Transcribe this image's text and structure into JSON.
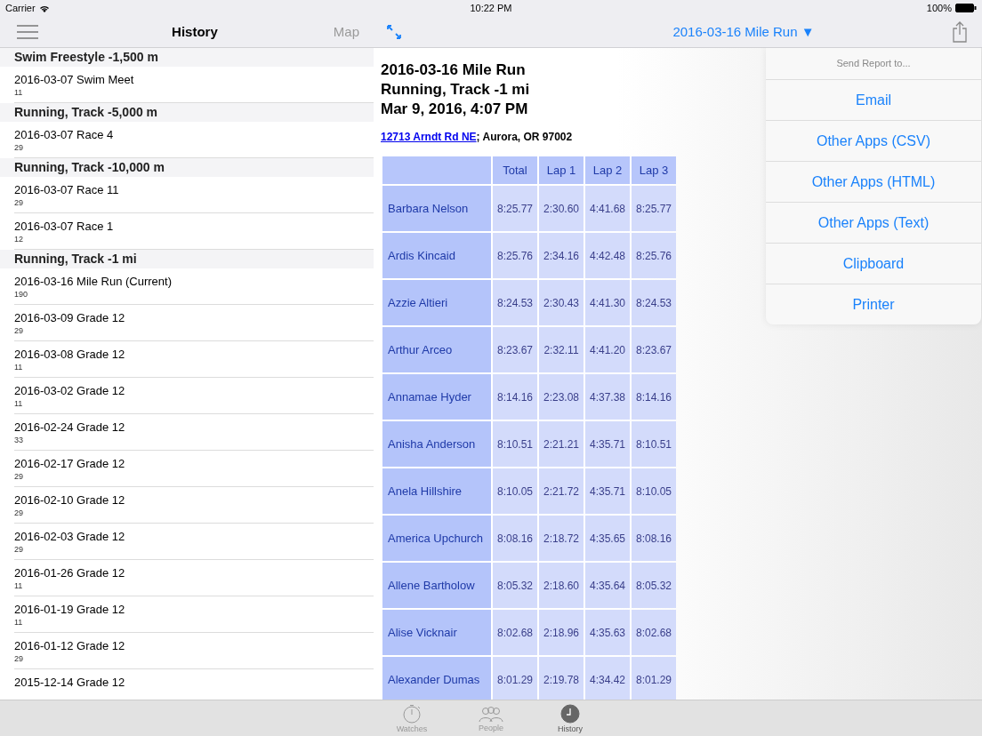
{
  "status_bar": {
    "carrier": "Carrier",
    "time": "10:22 PM",
    "battery": "100%"
  },
  "left_nav": {
    "title": "History",
    "action": "Map"
  },
  "history": [
    {
      "title": "Swim Freestyle -1,500 m",
      "items": [
        {
          "title": "2016-03-07 Swim Meet",
          "count": "11"
        }
      ]
    },
    {
      "title": "Running, Track -5,000 m",
      "items": [
        {
          "title": "2016-03-07 Race 4",
          "count": "29"
        }
      ]
    },
    {
      "title": "Running, Track -10,000 m",
      "items": [
        {
          "title": "2016-03-07 Race 11",
          "count": "29"
        },
        {
          "title": "2016-03-07 Race 1",
          "count": "12"
        }
      ]
    },
    {
      "title": "Running, Track -1 mi",
      "items": [
        {
          "title": "2016-03-16 Mile Run (Current)",
          "count": "190"
        },
        {
          "title": "2016-03-09 Grade 12",
          "count": "29"
        },
        {
          "title": "2016-03-08 Grade 12",
          "count": "11"
        },
        {
          "title": "2016-03-02 Grade 12",
          "count": "11"
        },
        {
          "title": "2016-02-24 Grade 12",
          "count": "33"
        },
        {
          "title": "2016-02-17 Grade 12",
          "count": "29"
        },
        {
          "title": "2016-02-10 Grade 12",
          "count": "29"
        },
        {
          "title": "2016-02-03 Grade 12",
          "count": "29"
        },
        {
          "title": "2016-01-26 Grade 12",
          "count": "11"
        },
        {
          "title": "2016-01-19 Grade 12",
          "count": "11"
        },
        {
          "title": "2016-01-12 Grade 12",
          "count": "29"
        },
        {
          "title": "2015-12-14 Grade 12"
        }
      ]
    }
  ],
  "right_nav": {
    "title": "2016-03-16 Mile Run",
    "caret": "▼"
  },
  "report": {
    "heading": [
      "2016-03-16 Mile Run",
      "Running, Track -1 mi",
      "Mar 9, 2016, 4:07 PM"
    ],
    "address_link": "12713 Arndt Rd NE",
    "address_rest": "; Aurora, OR 97002",
    "table": {
      "columns": [
        "Total",
        "Lap 1",
        "Lap 2",
        "Lap 3"
      ],
      "rows": [
        {
          "name": "Barbara Nelson",
          "values": [
            "8:25.77",
            "2:30.60",
            "4:41.68",
            "8:25.77"
          ]
        },
        {
          "name": "Ardis Kincaid",
          "values": [
            "8:25.76",
            "2:34.16",
            "4:42.48",
            "8:25.76"
          ]
        },
        {
          "name": "Azzie Altieri",
          "values": [
            "8:24.53",
            "2:30.43",
            "4:41.30",
            "8:24.53"
          ]
        },
        {
          "name": "Arthur Arceo",
          "values": [
            "8:23.67",
            "2:32.11",
            "4:41.20",
            "8:23.67"
          ]
        },
        {
          "name": "Annamae Hyder",
          "values": [
            "8:14.16",
            "2:23.08",
            "4:37.38",
            "8:14.16"
          ]
        },
        {
          "name": "Anisha Anderson",
          "values": [
            "8:10.51",
            "2:21.21",
            "4:35.71",
            "8:10.51"
          ]
        },
        {
          "name": "Anela Hillshire",
          "values": [
            "8:10.05",
            "2:21.72",
            "4:35.71",
            "8:10.05"
          ]
        },
        {
          "name": "America Upchurch",
          "values": [
            "8:08.16",
            "2:18.72",
            "4:35.65",
            "8:08.16"
          ]
        },
        {
          "name": "Allene Bartholow",
          "values": [
            "8:05.32",
            "2:18.60",
            "4:35.64",
            "8:05.32"
          ]
        },
        {
          "name": "Alise Vicknair",
          "values": [
            "8:02.68",
            "2:18.96",
            "4:35.63",
            "8:02.68"
          ]
        },
        {
          "name": "Alexander Dumas",
          "values": [
            "8:01.29",
            "2:19.78",
            "4:34.42",
            "8:01.29"
          ]
        }
      ]
    }
  },
  "popover": {
    "title": "Send Report to...",
    "items": [
      "Email",
      "Other Apps (CSV)",
      "Other Apps (HTML)",
      "Other Apps (Text)",
      "Clipboard",
      "Printer"
    ]
  },
  "tab_bar": [
    {
      "kind": "watch",
      "label": "Watches",
      "selected": false
    },
    {
      "kind": "people",
      "label": "People",
      "selected": false
    },
    {
      "kind": "clock",
      "label": "History",
      "selected": true
    }
  ]
}
